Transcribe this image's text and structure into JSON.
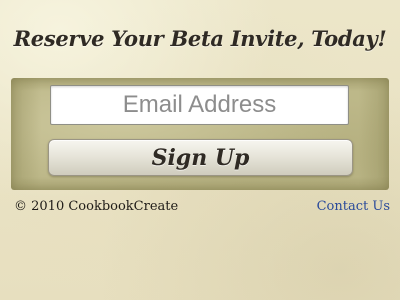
{
  "header": {
    "headline": "Reserve Your Beta Invite, Today!"
  },
  "form": {
    "email_placeholder": "Email Address",
    "email_value": "",
    "submit_label": "Sign Up"
  },
  "footer": {
    "copyright": "© 2010 CookbookCreate",
    "contact_label": "Contact Us"
  },
  "colors": {
    "background": "#eee8cc",
    "panel": "#bdb889",
    "text_dark": "#2f2a24",
    "link": "#2a4a9a"
  }
}
